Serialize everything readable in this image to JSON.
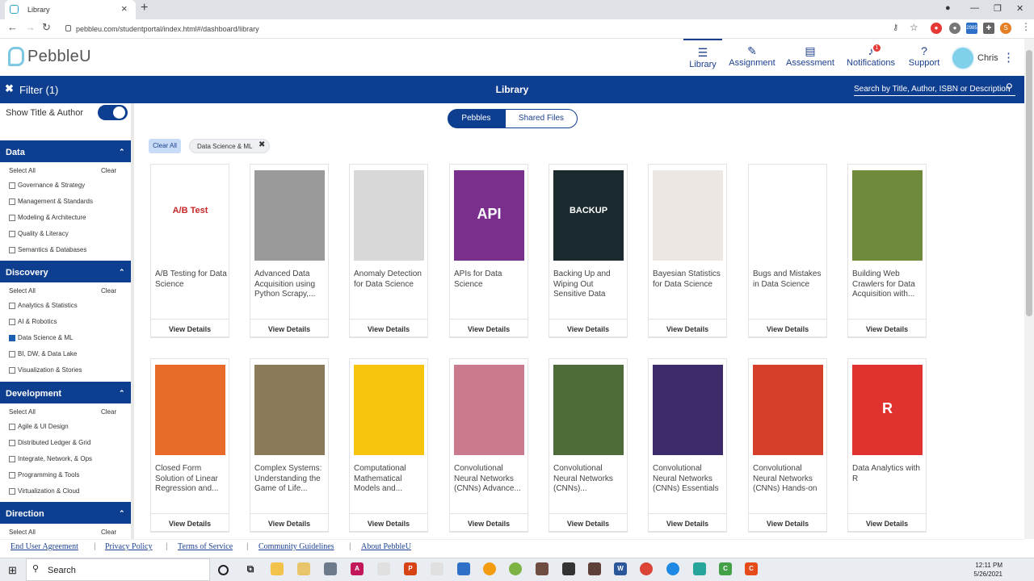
{
  "browser": {
    "tab_title": "Library",
    "url": "pebbleu.com/studentportal/index.html#/dashboard/library",
    "ext_badge": "2985",
    "profile_initial": "S"
  },
  "app": {
    "logo_text": "PebbleU",
    "nav": [
      {
        "label": "Library",
        "icon": "library-icon"
      },
      {
        "label": "Assignment",
        "icon": "assignment-icon"
      },
      {
        "label": "Assessment",
        "icon": "assessment-icon"
      },
      {
        "label": "Notifications",
        "icon": "bell-icon",
        "badge": "1"
      },
      {
        "label": "Support",
        "icon": "help-icon"
      }
    ],
    "user_name": "Chris"
  },
  "bar": {
    "filter_label": "Filter (1)",
    "title": "Library",
    "search_placeholder": "Search by Title, Author, ISBN or Description"
  },
  "sidebar": {
    "toggle_label": "Show Title & Author",
    "select_all": "Select All",
    "clear": "Clear",
    "sections": [
      {
        "title": "Data",
        "items": [
          {
            "label": "Governance & Strategy",
            "checked": false
          },
          {
            "label": "Management & Standards",
            "checked": false
          },
          {
            "label": "Modeling & Architecture",
            "checked": false
          },
          {
            "label": "Quality & Literacy",
            "checked": false
          },
          {
            "label": "Semantics & Databases",
            "checked": false
          }
        ]
      },
      {
        "title": "Discovery",
        "items": [
          {
            "label": "Analytics & Statistics",
            "checked": false
          },
          {
            "label": "AI & Robotics",
            "checked": false
          },
          {
            "label": "Data Science & ML",
            "checked": true
          },
          {
            "label": "BI, DW, & Data Lake",
            "checked": false
          },
          {
            "label": "Visualization & Stories",
            "checked": false
          }
        ]
      },
      {
        "title": "Development",
        "items": [
          {
            "label": "Agile & UI Design",
            "checked": false
          },
          {
            "label": "Distributed Ledger & Grid",
            "checked": false
          },
          {
            "label": "Integrate, Network, & Ops",
            "checked": false
          },
          {
            "label": "Programming & Tools",
            "checked": false
          },
          {
            "label": "Virtualization & Cloud",
            "checked": false
          }
        ]
      },
      {
        "title": "Direction",
        "items": []
      }
    ]
  },
  "main": {
    "segments": [
      "Pebbles",
      "Shared Files"
    ],
    "clear_all": "Clear All",
    "active_filter": "Data Science & ML",
    "view_details": "View Details",
    "books": [
      {
        "title": "A/B Testing for Data Science",
        "cover": "#ffffff",
        "cover_text": "A/B Test"
      },
      {
        "title": "Advanced Data Acquisition using Python Scrapy,...",
        "cover": "#9a9a9a"
      },
      {
        "title": "Anomaly Detection for Data Science",
        "cover": "#d8d8d8"
      },
      {
        "title": "APIs for Data Science",
        "cover": "#7a2f8c",
        "cover_text": "API"
      },
      {
        "title": "Backing Up and Wiping Out Sensitive Data",
        "cover": "#1a2a2e",
        "cover_text": "BACKUP"
      },
      {
        "title": "Bayesian Statistics for Data Science",
        "cover": "#ece7e3"
      },
      {
        "title": "Bugs and Mistakes in Data Science",
        "cover": "#ffffff"
      },
      {
        "title": "Building Web Crawlers for Data Acquisition with...",
        "cover": "#6f8a3a"
      },
      {
        "title": "Closed Form Solution of Linear Regression and...",
        "cover": "#e86b2a"
      },
      {
        "title": "Complex Systems: Understanding the Game of Life...",
        "cover": "#8a7a5a"
      },
      {
        "title": "Computational Mathematical Models and...",
        "cover": "#f6c40c"
      },
      {
        "title": "Convolutional Neural Networks (CNNs) Advance...",
        "cover": "#c97b8d"
      },
      {
        "title": "Convolutional Neural Networks (CNNs)...",
        "cover": "#4e6b3a"
      },
      {
        "title": "Convolutional Neural Networks (CNNs) Essentials",
        "cover": "#3d2a6b"
      },
      {
        "title": "Convolutional Neural Networks (CNNs) Hands-on",
        "cover": "#d6402a"
      },
      {
        "title": "Data Analytics with R",
        "cover": "#e0322f",
        "cover_text": "R"
      }
    ]
  },
  "footer": {
    "links": [
      "End User Agreement",
      "Privacy Policy",
      "Terms of Service",
      "Community Guidelines",
      "About PebbleU"
    ]
  },
  "taskbar": {
    "search_label": "Search",
    "time": "12:11 PM",
    "date": "5/26/2021"
  }
}
